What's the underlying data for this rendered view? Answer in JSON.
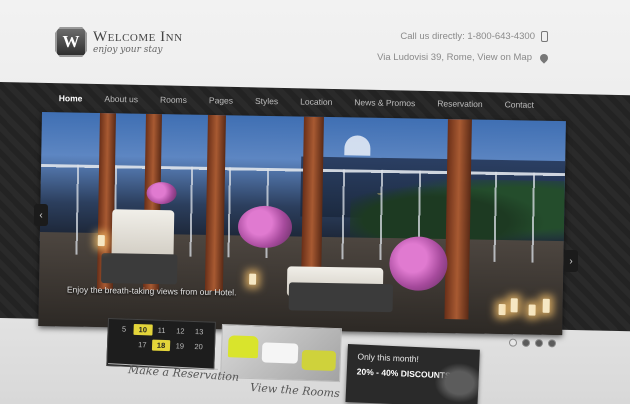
{
  "brand": {
    "logo_letter": "W",
    "name": "Welcome Inn",
    "tagline": "enjoy your stay"
  },
  "contact": {
    "phone_text": "Call us directly: 1-800-643-4300",
    "address_text": "Via Ludovisi 39, Rome, View on Map",
    "phone_icon": "phone-icon",
    "map_icon": "map-pin-icon"
  },
  "nav": {
    "items": [
      {
        "label": "Home",
        "active": true
      },
      {
        "label": "About us",
        "active": false
      },
      {
        "label": "Rooms",
        "active": false
      },
      {
        "label": "Pages",
        "active": false
      },
      {
        "label": "Styles",
        "active": false
      },
      {
        "label": "Location",
        "active": false
      },
      {
        "label": "News & Promos",
        "active": false
      },
      {
        "label": "Reservation",
        "active": false
      },
      {
        "label": "Contact",
        "active": false
      }
    ]
  },
  "slider": {
    "caption": "Enjoy the breath-taking views from our Hotel.",
    "prev_label": "‹",
    "next_label": "›",
    "slide_count": 4,
    "active_slide": 1
  },
  "calendar": {
    "days": [
      "5",
      "10",
      "11",
      "12",
      "13",
      "",
      "17",
      "18",
      "19",
      "20"
    ],
    "highlighted": [
      "10",
      "18"
    ]
  },
  "promo": {
    "line1": "Only this month!",
    "line2": "20% - 40% DISCOUNTS"
  },
  "labels": {
    "reservation": "Make a Reservation",
    "rooms": "View the Rooms"
  },
  "colors": {
    "accent_yellow": "#e3d43a",
    "band_dark": "#262626",
    "nav_active": "#ffffff"
  }
}
